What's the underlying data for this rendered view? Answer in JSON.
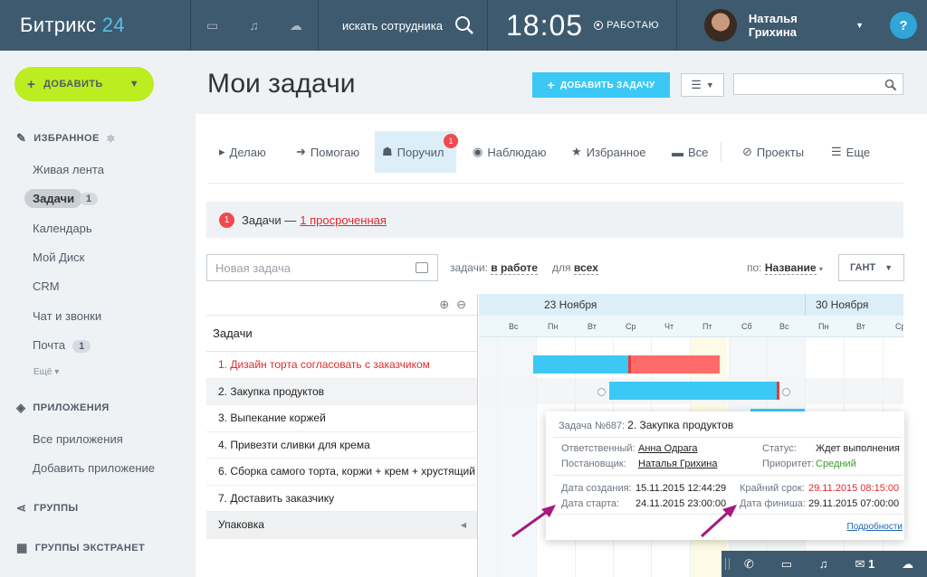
{
  "topbar": {
    "logo_text": "Битрикс",
    "logo_num": "24",
    "search_text": "искать сотрудника",
    "time": "18:05",
    "work_status": "РАБОТАЮ",
    "user_name": "Наталья Грихина",
    "help": "?"
  },
  "sidebar": {
    "add_label": "ДОБАВИТЬ",
    "favorites_title": "ИЗБРАННОЕ",
    "items": [
      {
        "label": "Живая лента"
      },
      {
        "label": "Задачи",
        "count": "1"
      },
      {
        "label": "Календарь"
      },
      {
        "label": "Мой Диск"
      },
      {
        "label": "CRM"
      },
      {
        "label": "Чат и звонки"
      },
      {
        "label": "Почта",
        "count": "1"
      }
    ],
    "more": "Ещё",
    "apps_title": "ПРИЛОЖЕНИЯ",
    "apps": [
      {
        "label": "Все приложения"
      },
      {
        "label": "Добавить приложение"
      }
    ],
    "groups_title": "ГРУППЫ",
    "extranet_title": "ГРУППЫ ЭКСТРАНЕТ"
  },
  "main": {
    "title": "Мои задачи",
    "add_task": "ДОБАВИТЬ ЗАДАЧУ",
    "tabs": [
      {
        "label": "Делаю"
      },
      {
        "label": "Помогаю"
      },
      {
        "label": "Поручил",
        "badge": "1"
      },
      {
        "label": "Наблюдаю"
      },
      {
        "label": "Избранное"
      },
      {
        "label": "Все"
      },
      {
        "label": "Проекты"
      },
      {
        "label": "Еще"
      }
    ],
    "overdue": {
      "count": "1",
      "label": "Задачи —",
      "link": "1 просроченная"
    },
    "new_task_placeholder": "Новая задача",
    "filter_tasks_label": "задачи:",
    "filter_tasks_value": "в работе",
    "filter_for_label": "для",
    "filter_for_value": "всех",
    "sort_label": "по:",
    "sort_value": "Название",
    "view_mode": "ГАНТ"
  },
  "gantt": {
    "tasks_header": "Задачи",
    "tasks": [
      {
        "label": "1. Дизайн торта согласовать с заказчиком",
        "overdue": true
      },
      {
        "label": "2. Закупка продуктов"
      },
      {
        "label": "3. Выпекание коржей"
      },
      {
        "label": "4. Привезти сливки для крема"
      },
      {
        "label": "6. Сборка самого торта, коржи + крем + хрустящий"
      },
      {
        "label": "7. Доставить заказчику"
      }
    ],
    "group_label": "Упаковка",
    "months": [
      "23 Ноября",
      "30 Ноября"
    ],
    "days": [
      "Вс",
      "Пн",
      "Вт",
      "Ср",
      "Чт",
      "Пт",
      "Сб",
      "Вс",
      "Пн",
      "Вт",
      "Ср"
    ]
  },
  "popup": {
    "task_no_label": "Задача №687:",
    "task_title": "2. Закупка продуктов",
    "responsible_label": "Ответственный:",
    "responsible": "Анна Одрага",
    "creator_label": "Постановщик:",
    "creator": "Наталья Грихина",
    "status_label": "Статус:",
    "status": "Ждет выполнения",
    "priority_label": "Приоритет:",
    "priority": "Средний",
    "created_label": "Дата создания:",
    "created_date": "15.11.2015",
    "created_time": "12:44:29",
    "start_label": "Дата старта:",
    "start_date": "24.11.2015",
    "start_time": "23:00:00",
    "deadline_label": "Крайний срок:",
    "deadline": "29.11.2015 08:15:00",
    "finish_label": "Дата финиша:",
    "finish_date": "29.11.2015",
    "finish_time": "07:00:00",
    "details": "Подробности"
  },
  "bottombar": {
    "mail_count": "1"
  },
  "colors": {
    "topbar": "#3e5a6e",
    "accent": "#3bc8f5",
    "add_button": "#bbed21",
    "overdue": "#e1292e",
    "bar_overdue": "#ff6b6b",
    "arrow": "#a6197d"
  }
}
